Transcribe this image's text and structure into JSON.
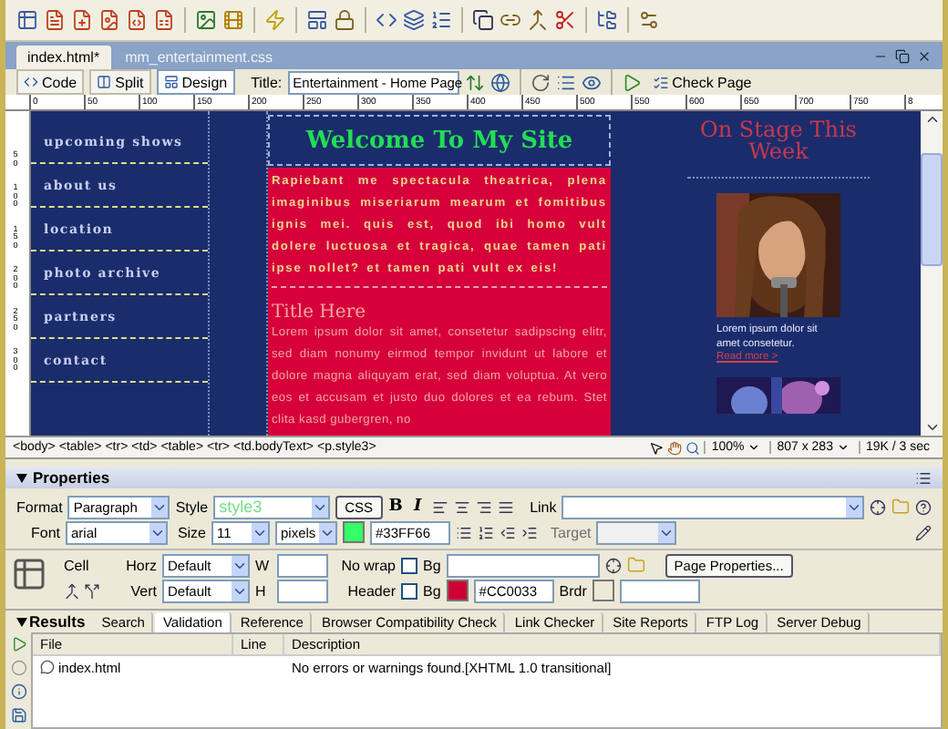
{
  "document_tabs": [
    {
      "label": "index.html*",
      "selected": true
    },
    {
      "label": "mm_entertainment.css",
      "selected": false
    }
  ],
  "view_buttons": [
    {
      "label": "Code",
      "selected": false
    },
    {
      "label": "Split",
      "selected": false
    },
    {
      "label": "Design",
      "selected": true
    }
  ],
  "page_title": {
    "label": "Title:",
    "value": "Entertainment - Home Page"
  },
  "check_page": "Check Page",
  "ruler": [
    "0",
    "50",
    "100",
    "150",
    "200",
    "250",
    "300",
    "350",
    "400",
    "450",
    "500",
    "550",
    "600",
    "650",
    "700",
    "750",
    "8"
  ],
  "vertical_ruler": [
    "50",
    "100",
    "150",
    "200",
    "250",
    "300"
  ],
  "page": {
    "nav": [
      "upcoming shows",
      "about us",
      "location",
      "photo archive",
      "partners",
      "contact"
    ],
    "heading": "Welcome To My Site",
    "intro": "Rapiebant me spectacula theatrica, plena imaginibus miseriarum mearum et fomitibus ignis mei. quis est, quod ibi homo vult dolere luctuosa et tragica, quae tamen pati ipse nollet? et tamen pati vult ex eis!",
    "subheading": "Title Here",
    "body": "Lorem ipsum dolor sit amet, consetetur sadipscing elitr, sed diam nonumy eirmod tempor invidunt ut labore et dolore magna aliquyam erat, sed diam voluptua. At vero eos et accusam et justo duo dolores et ea rebum. Stet clita kasd gubergren, no",
    "sidebar": {
      "heading": "On Stage This Week",
      "caption": "Lorem ipsum dolor sit amet consetetur.",
      "link": "Read more >"
    }
  },
  "tag_selector": [
    "<body>",
    "<table>",
    "<tr>",
    "<td>",
    "<table>",
    "<tr>",
    "<td.bodyText>",
    "<p.style3>"
  ],
  "status": {
    "zoom": "100%",
    "size": "807 x 283",
    "download": "19K / 3 sec"
  },
  "properties": {
    "title": "Properties",
    "format": {
      "label": "Format",
      "value": "Paragraph"
    },
    "style": {
      "label": "Style",
      "value": "style3"
    },
    "css": "CSS",
    "bold": "B",
    "italic": "I",
    "link": {
      "label": "Link"
    },
    "font": {
      "label": "Font",
      "value": "arial"
    },
    "size": {
      "label": "Size",
      "value": "11",
      "unit": "pixels"
    },
    "text_color": "#33FF66",
    "target": {
      "label": "Target",
      "disabled": true
    },
    "cell": {
      "label": "Cell",
      "horz": {
        "label": "Horz",
        "value": "Default"
      },
      "vert": {
        "label": "Vert",
        "value": "Default"
      },
      "width_label": "W",
      "height_label": "H",
      "no_wrap": {
        "label": "No wrap",
        "checked": false
      },
      "header": {
        "label": "Header",
        "checked": false
      },
      "bg_label": "Bg",
      "bg2_label": "Bg",
      "bg_color": "#CC0033",
      "border_label": "Brdr"
    },
    "page_properties": "Page Properties..."
  },
  "results": {
    "title": "Results",
    "tabs": [
      {
        "label": "Search",
        "selected": false
      },
      {
        "label": "Validation",
        "selected": true
      },
      {
        "label": "Reference",
        "selected": false
      },
      {
        "label": "Browser Compatibility Check",
        "selected": false
      },
      {
        "label": "Link Checker",
        "selected": false
      },
      {
        "label": "Site Reports",
        "selected": false
      },
      {
        "label": "FTP Log",
        "selected": false
      },
      {
        "label": "Server Debug",
        "selected": false
      }
    ],
    "columns": [
      "File",
      "Line",
      "Description"
    ],
    "rows": [
      {
        "file": "index.html",
        "description": "No errors or warnings found.[XHTML 1.0 transitional]"
      }
    ]
  }
}
